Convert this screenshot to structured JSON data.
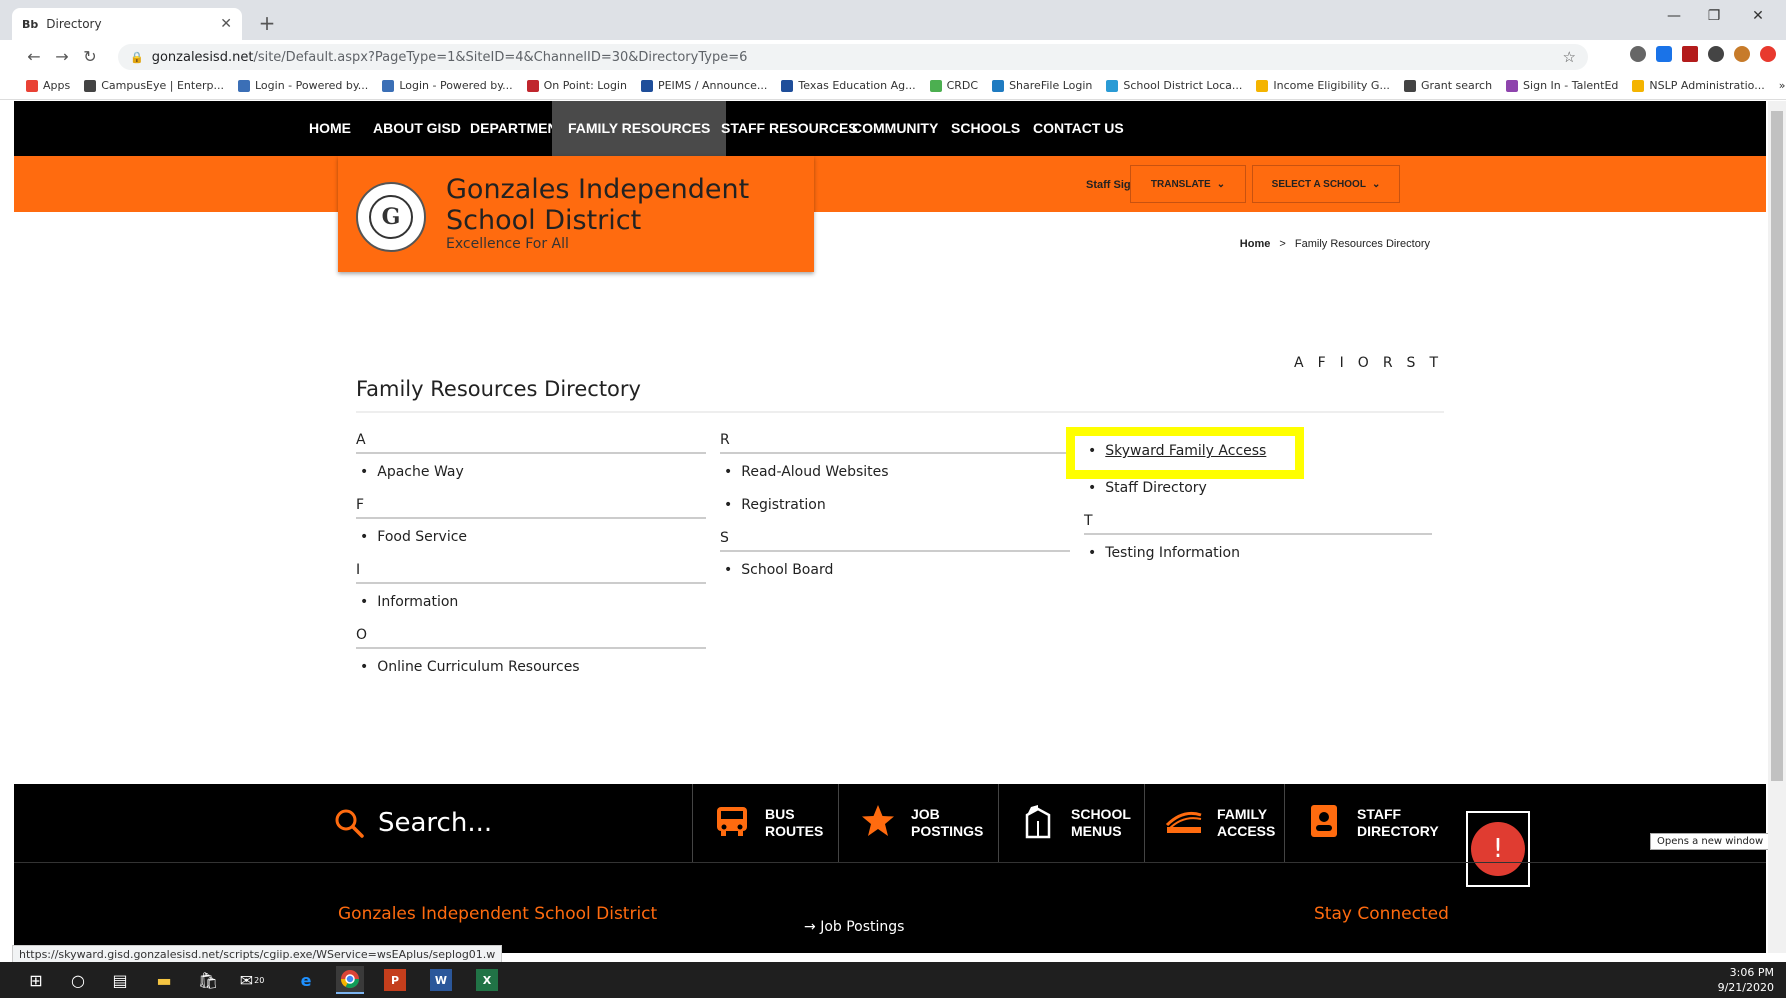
{
  "browser": {
    "tab_title": "Directory",
    "tab_favicon": "Bb",
    "new_tab": "+",
    "url_host": "gonzalesisd.net",
    "url_path": "/site/Default.aspx?PageType=1&SiteID=4&ChannelID=30&DirectoryType=6",
    "bookmarks": [
      {
        "label": "Apps",
        "color": "#e94235"
      },
      {
        "label": "CampusEye | Enterp...",
        "color": "#444444"
      },
      {
        "label": "Login - Powered by...",
        "color": "#3b6fb6"
      },
      {
        "label": "Login - Powered by...",
        "color": "#3b6fb6"
      },
      {
        "label": "On Point: Login",
        "color": "#c0262d"
      },
      {
        "label": "PEIMS / Announce...",
        "color": "#1f4e9a"
      },
      {
        "label": "Texas Education Ag...",
        "color": "#1f4e9a"
      },
      {
        "label": "CRDC",
        "color": "#4caf50"
      },
      {
        "label": "ShareFile Login",
        "color": "#1f7bc1"
      },
      {
        "label": "School District Loca...",
        "color": "#2a9bd5"
      },
      {
        "label": "Income Eligibility G...",
        "color": "#f4b400"
      },
      {
        "label": "Grant search",
        "color": "#444444"
      },
      {
        "label": "Sign In - TalentEd",
        "color": "#8e44ad"
      },
      {
        "label": "NSLP Administratio...",
        "color": "#f4b400"
      }
    ],
    "bookmarks_more": "»",
    "status_url": "https://skyward.gisd.gonzalesisd.net/scripts/cgiip.exe/WService=wsEAplus/seplog01.w"
  },
  "nav": {
    "items": [
      "HOME",
      "ABOUT GISD",
      "DEPARTMENTS",
      "FAMILY RESOURCES",
      "STAFF RESOURCES",
      "COMMUNITY",
      "SCHOOLS",
      "CONTACT US"
    ],
    "active_index": 3
  },
  "header": {
    "district_name": "Gonzales Independent School District",
    "tagline": "Excellence For All",
    "seal_letter": "G",
    "staff_sign_in": "Staff Sign In",
    "translate": "TRANSLATE",
    "select_school": "SELECT A SCHOOL",
    "accent_color": "#ff6b0f"
  },
  "breadcrumb": {
    "home": "Home",
    "separator": ">",
    "current": "Family Resources Directory"
  },
  "directory": {
    "title": "Family Resources Directory",
    "letters": [
      "A",
      "F",
      "I",
      "O",
      "R",
      "S",
      "T"
    ],
    "columns": [
      {
        "groups": [
          {
            "letter": "A",
            "items": [
              "Apache Way"
            ]
          },
          {
            "letter": "F",
            "items": [
              "Food Service"
            ]
          },
          {
            "letter": "I",
            "items": [
              "Information"
            ]
          },
          {
            "letter": "O",
            "items": [
              "Online Curriculum Resources"
            ]
          }
        ]
      },
      {
        "groups": [
          {
            "letter": "R",
            "items": [
              "Read-Aloud Websites",
              "Registration"
            ]
          },
          {
            "letter": "S",
            "items": [
              "School Board"
            ]
          }
        ]
      }
    ],
    "col3_top_items": [
      "Skyward Family Access",
      "Staff Directory"
    ],
    "col3_groups": [
      {
        "letter": "T",
        "items": [
          "Testing Information"
        ]
      }
    ],
    "highlight_color": "#ffff00"
  },
  "footer": {
    "search_placeholder": "Search...",
    "quick_links": [
      {
        "line1": "BUS",
        "line2": "ROUTES",
        "icon": "bus-icon"
      },
      {
        "line1": "JOB",
        "line2": "POSTINGS",
        "icon": "star-icon"
      },
      {
        "line1": "SCHOOL",
        "line2": "MENUS",
        "icon": "milk-carton-icon"
      },
      {
        "line1": "FAMILY",
        "line2": "ACCESS",
        "icon": "skyward-icon"
      },
      {
        "line1": "STAFF",
        "line2": "DIRECTORY",
        "icon": "id-card-icon"
      }
    ],
    "district_title": "Gonzales Independent School District",
    "job_postings_link": "Job Postings",
    "stay_connected": "Stay Connected",
    "alert_symbol": "!",
    "new_window_tip": "Opens a new window"
  },
  "taskbar": {
    "time": "3:06 PM",
    "date": "9/21/2020",
    "mail_badge": "20"
  }
}
